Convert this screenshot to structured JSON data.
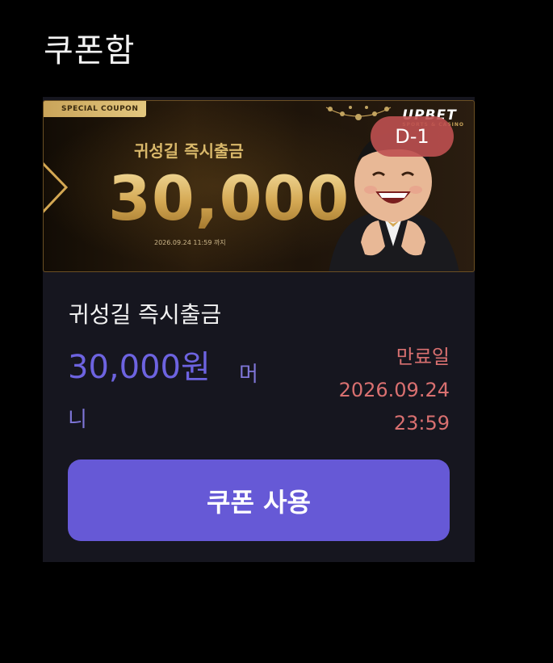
{
  "page": {
    "title": "쿠폰함"
  },
  "coupon": {
    "banner": {
      "tag": "SPECIAL COUPON",
      "subtitle": "귀성길 즉시출금",
      "amount": "30,000",
      "date": "2026.09.24 11:59 까지",
      "brand": "UPBET",
      "brand_tagline": "SPORTS & CASINO"
    },
    "dday_badge": "D-1",
    "name": "귀성길 즉시출금",
    "amount": "30,000원",
    "amount_unit": "머니",
    "expiry": {
      "label": "만료일",
      "date": "2026.09.24",
      "time": "23:59"
    },
    "use_button": "쿠폰 사용"
  },
  "colors": {
    "background": "#000000",
    "card": "#16161f",
    "accent": "#6659d6",
    "amount": "#6d63e0",
    "expiry": "#d97070",
    "badge": "#be5050",
    "gold": "#d4a853"
  }
}
